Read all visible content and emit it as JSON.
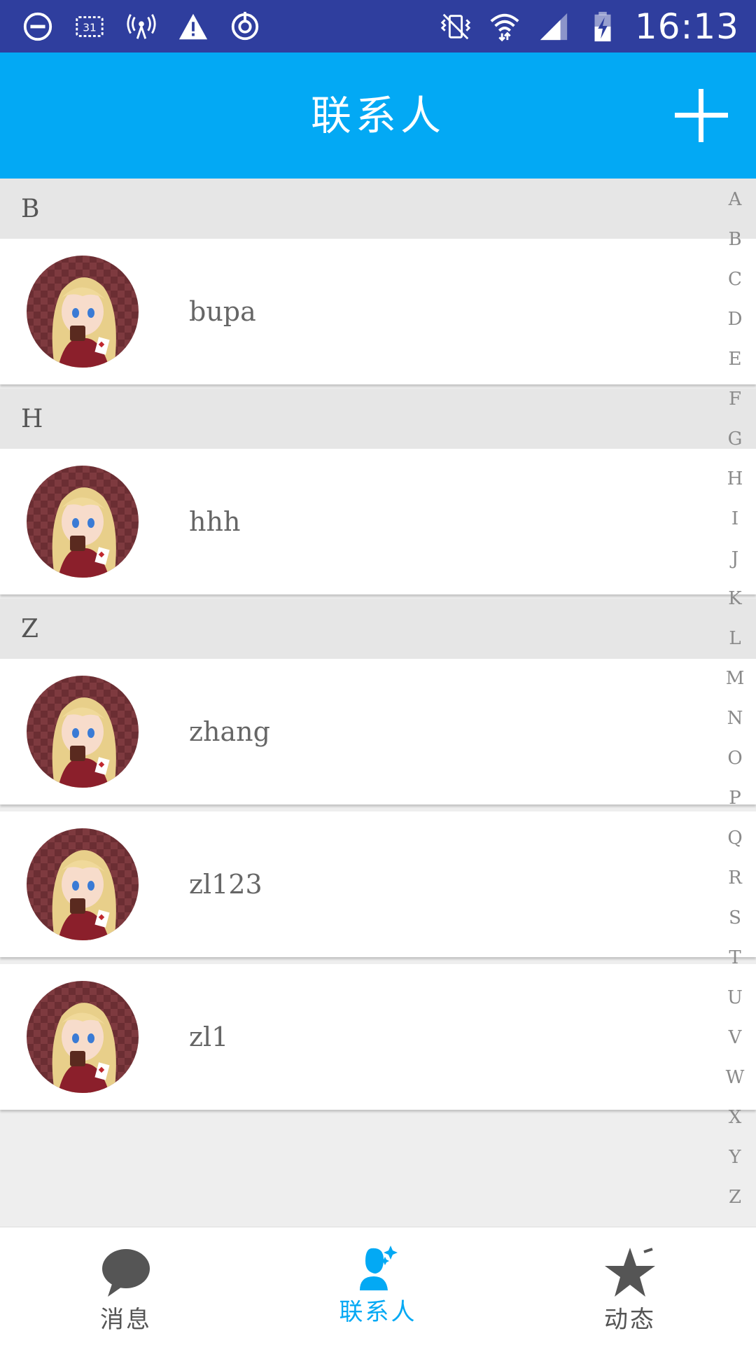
{
  "status_bar": {
    "time": "16:13",
    "icons_left": [
      "do-not-disturb-icon",
      "calendar-icon",
      "signal-broadcast-icon",
      "warning-icon",
      "sync-icon"
    ],
    "calendar_day": "31",
    "icons_right": [
      "vibrate-icon",
      "wifi-icon",
      "cell-signal-icon",
      "battery-charging-icon"
    ]
  },
  "app_bar": {
    "title": "联系人",
    "add_icon": "plus-icon",
    "color": "#03a9f4"
  },
  "contact_groups": [
    {
      "letter": "B",
      "contacts": [
        {
          "name": "bupa"
        }
      ]
    },
    {
      "letter": "H",
      "contacts": [
        {
          "name": "hhh"
        }
      ]
    },
    {
      "letter": "Z",
      "contacts": [
        {
          "name": "zhang"
        },
        {
          "name": "zl123"
        },
        {
          "name": "zl1"
        }
      ]
    }
  ],
  "alphabet_index": [
    "A",
    "B",
    "C",
    "D",
    "E",
    "F",
    "G",
    "H",
    "I",
    "J",
    "K",
    "L",
    "M",
    "N",
    "O",
    "P",
    "Q",
    "R",
    "S",
    "T",
    "U",
    "V",
    "W",
    "X",
    "Y",
    "Z"
  ],
  "bottom_nav": {
    "tabs": [
      {
        "label": "消息",
        "icon": "chat-bubble-icon",
        "active": false
      },
      {
        "label": "联系人",
        "icon": "contacts-person-icon",
        "active": true
      },
      {
        "label": "动态",
        "icon": "star-icon",
        "active": false
      }
    ],
    "active_color": "#03a9f4",
    "inactive_color": "#555555"
  }
}
